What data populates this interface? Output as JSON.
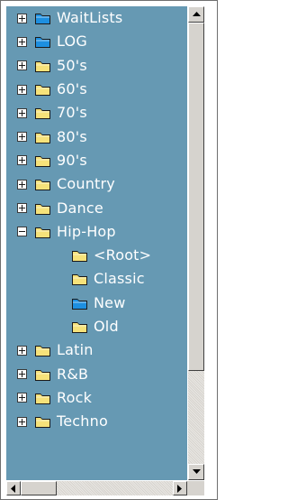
{
  "tree": {
    "background": "#6699b3",
    "text_color": "#ffffff",
    "items": [
      {
        "label": "WaitLists",
        "level": 0,
        "toggle": "plus",
        "icon": "folder-blue-icon"
      },
      {
        "label": "LOG",
        "level": 0,
        "toggle": "plus",
        "icon": "folder-blue-icon"
      },
      {
        "label": "50's",
        "level": 0,
        "toggle": "plus",
        "icon": "folder-icon"
      },
      {
        "label": "60's",
        "level": 0,
        "toggle": "plus",
        "icon": "folder-icon"
      },
      {
        "label": "70's",
        "level": 0,
        "toggle": "plus",
        "icon": "folder-icon"
      },
      {
        "label": "80's",
        "level": 0,
        "toggle": "plus",
        "icon": "folder-icon"
      },
      {
        "label": "90's",
        "level": 0,
        "toggle": "plus",
        "icon": "folder-icon"
      },
      {
        "label": "Country",
        "level": 0,
        "toggle": "plus",
        "icon": "folder-icon"
      },
      {
        "label": "Dance",
        "level": 0,
        "toggle": "plus",
        "icon": "folder-icon"
      },
      {
        "label": "Hip-Hop",
        "level": 0,
        "toggle": "minus",
        "icon": "folder-icon"
      },
      {
        "label": "<Root>",
        "level": 1,
        "toggle": "none",
        "icon": "folder-icon"
      },
      {
        "label": "Classic",
        "level": 1,
        "toggle": "none",
        "icon": "folder-icon"
      },
      {
        "label": "New",
        "level": 1,
        "toggle": "none",
        "icon": "folder-blue-icon"
      },
      {
        "label": "Old",
        "level": 1,
        "toggle": "none",
        "icon": "folder-icon"
      },
      {
        "label": "Latin",
        "level": 0,
        "toggle": "plus",
        "icon": "folder-icon"
      },
      {
        "label": "R&B",
        "level": 0,
        "toggle": "plus",
        "icon": "folder-icon"
      },
      {
        "label": "Rock",
        "level": 0,
        "toggle": "plus",
        "icon": "folder-icon"
      },
      {
        "label": "Techno",
        "level": 0,
        "toggle": "plus",
        "icon": "folder-icon"
      }
    ]
  },
  "scrollbars": {
    "vertical": {
      "up_icon": "arrow-up-icon",
      "down_icon": "arrow-down-icon"
    },
    "horizontal": {
      "left_icon": "arrow-left-icon",
      "right_icon": "arrow-right-icon"
    }
  },
  "colors": {
    "folder_yellow": "#f6e27a",
    "folder_blue": "#1d8fe0",
    "scroll_face": "#d6d3ce"
  }
}
